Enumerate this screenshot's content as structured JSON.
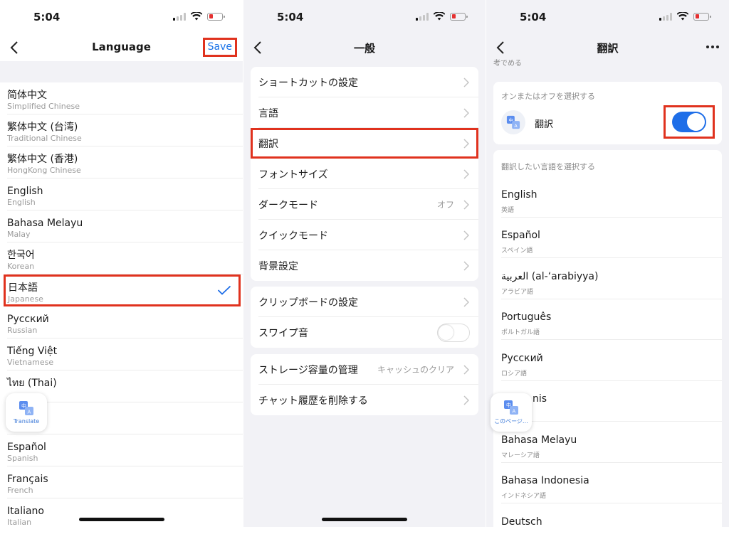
{
  "status": {
    "time": "5:04"
  },
  "panel1": {
    "title": "Language",
    "save_label": "Save",
    "languages": [
      {
        "name": "简体中文",
        "sub": "Simplified Chinese"
      },
      {
        "name": "繁体中文 (台湾)",
        "sub": "Traditional Chinese"
      },
      {
        "name": "繁体中文 (香港)",
        "sub": "HongKong Chinese"
      },
      {
        "name": "English",
        "sub": "English"
      },
      {
        "name": "Bahasa Melayu",
        "sub": "Malay"
      },
      {
        "name": "한국어",
        "sub": "Korean"
      },
      {
        "name": "日本語",
        "sub": "Japanese",
        "selected": true
      },
      {
        "name": "Русский",
        "sub": "Russian"
      },
      {
        "name": "Tiếng Việt",
        "sub": "Vietnamese"
      },
      {
        "name": "ไทย (Thai)",
        "sub": ""
      },
      {
        "name": "",
        "sub": ""
      },
      {
        "name": "Español",
        "sub": "Spanish"
      },
      {
        "name": "Français",
        "sub": "French"
      },
      {
        "name": "Italiano",
        "sub": "Italian"
      }
    ],
    "float_label": "Translate"
  },
  "panel2": {
    "title": "一般",
    "group1": [
      {
        "label": "ショートカットの設定"
      },
      {
        "label": "言語"
      },
      {
        "label": "翻訳",
        "highlighted": true
      },
      {
        "label": "フォントサイズ"
      },
      {
        "label": "ダークモード",
        "value": "オフ"
      },
      {
        "label": "クイックモード"
      },
      {
        "label": "背景設定"
      }
    ],
    "group2": [
      {
        "label": "クリップボードの設定"
      },
      {
        "label": "スワイプ音",
        "toggle": false
      }
    ],
    "group3": [
      {
        "label": "ストレージ容量の管理",
        "value": "キャッシュのクリア"
      },
      {
        "label": "チャット履歴を削除する"
      }
    ]
  },
  "panel3": {
    "title": "翻訳",
    "clipped_text": "考でめる",
    "onoff_header": "オンまたはオフを選択する",
    "translate_label": "翻訳",
    "translate_on": true,
    "lang_header": "翻訳したい言語を選択する",
    "languages": [
      {
        "name": "English",
        "sub": "英語"
      },
      {
        "name": "Español",
        "sub": "スペイン語"
      },
      {
        "name": "العربية (al-‘arabiyya)",
        "sub": "アラビア語"
      },
      {
        "name": "Português",
        "sub": "ポルトガル語"
      },
      {
        "name": "Русский",
        "sub": "ロシア語"
      },
      {
        "name": "nis",
        "sub": ""
      },
      {
        "name": "Bahasa Melayu",
        "sub": "マレーシア語"
      },
      {
        "name": "Bahasa Indonesia",
        "sub": "インドネシア語"
      },
      {
        "name": "Deutsch",
        "sub": ""
      }
    ],
    "float_label": "このページ…"
  },
  "colors": {
    "highlight": "#e0321e",
    "accent": "#1e6ee8",
    "link": "#1a73e8"
  }
}
